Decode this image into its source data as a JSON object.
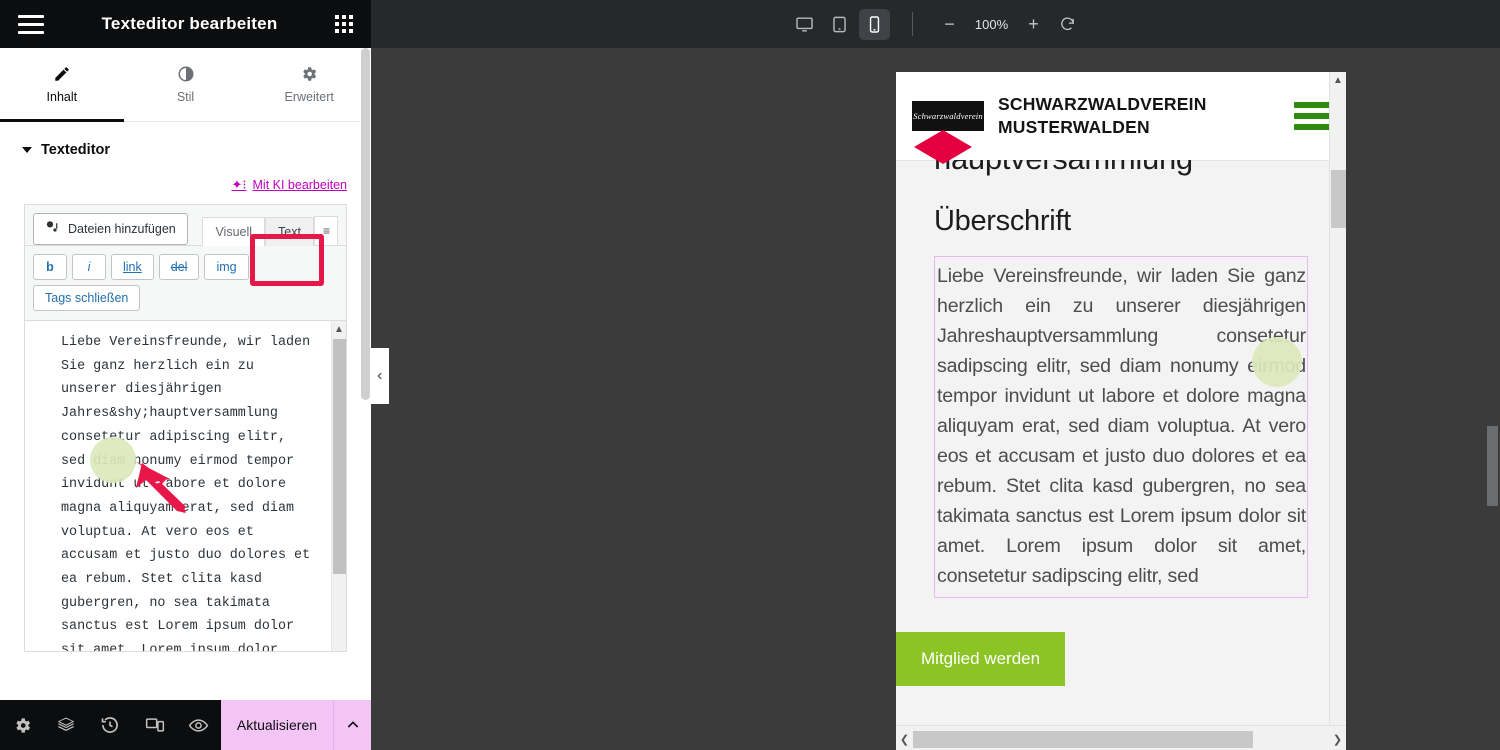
{
  "panel": {
    "title": "Texteditor bearbeiten",
    "menu_icon": "hamburger-icon",
    "apps_icon": "grid-apps-icon",
    "tabs": [
      {
        "label": "Inhalt",
        "icon": "pencil-icon",
        "active": true
      },
      {
        "label": "Stil",
        "icon": "contrast-icon",
        "active": false
      },
      {
        "label": "Erweitert",
        "icon": "gear-icon",
        "active": false
      }
    ],
    "section_title": "Texteditor",
    "ai_link": "Mit KI bearbeiten",
    "ai_icon": "sparkle-icon",
    "add_media": "Dateien hinzufügen",
    "add_media_icon": "media-camera-icon",
    "editor_tabs": [
      {
        "label": "Visuell",
        "selected": false
      },
      {
        "label": "Text",
        "selected": true
      }
    ],
    "kebab_icon": "kebab-menu-icon",
    "quicktags": [
      "b",
      "i",
      "link",
      "del",
      "img",
      "Tags schließen"
    ],
    "textarea_value": "Liebe Vereinsfreunde, wir laden Sie ganz herzlich ein zu unserer diesjährigen Jahres&shy;hauptversammlung consetetur adipiscing elitr, sed diam nonumy eirmod tempor invidunt ut labore et dolore magna aliquyam erat, sed diam voluptua. At vero eos et accusam et justo duo dolores et ea rebum. Stet clita kasd gubergren, no sea takimata sanctus est Lorem ipsum dolor sit amet. Lorem ipsum dolor",
    "footer": {
      "icons": [
        {
          "name": "settings-gear-icon"
        },
        {
          "name": "layers-navigator-icon"
        },
        {
          "name": "history-icon"
        },
        {
          "name": "responsive-preview-icon"
        },
        {
          "name": "preview-eye-icon"
        }
      ],
      "update_label": "Aktualisieren",
      "update_caret_icon": "chevron-up-icon",
      "update_color": "#f3c5f7"
    },
    "collapse_icon": "chevron-left-icon"
  },
  "topbar": {
    "devices": [
      {
        "name": "desktop",
        "icon": "desktop-icon",
        "active": false
      },
      {
        "name": "tablet",
        "icon": "tablet-icon",
        "active": false
      },
      {
        "name": "mobile",
        "icon": "mobile-icon",
        "active": true
      }
    ],
    "zoom_out_icon": "minus-icon",
    "zoom_level": "100%",
    "zoom_in_icon": "plus-icon",
    "zoom_reset_icon": "reset-rotate-icon"
  },
  "preview": {
    "logo_text": "Schwarzwaldverein",
    "site_name_line1": "SCHWARZWALDVEREIN",
    "site_name_line2": "MUSTERWALDEN",
    "menu_icon": "hamburger-green-icon",
    "menu_color": "#2e8b0b",
    "diamond_color": "#e4003f",
    "heading_cut": "hauptversammlung",
    "sub_heading": "Überschrift",
    "body_text": "Liebe Vereinsfreunde, wir laden Sie ganz herzlich ein zu unserer diesjährigen Jahres­hauptversammlung consetetur sadipscing elitr, sed diam nonumy eirmod tempor invidunt ut labore et dolore magna aliquyam erat, sed diam voluptua. At vero eos et accusam et justo duo dolores et ea rebum. Stet clita kasd gubergren, no sea takimata sanctus est Lorem ipsum dolor sit amet. Lorem ipsum dolor sit amet, consetetur sadipscing elitr, sed",
    "cta_label": "Mitglied werden",
    "cta_color": "#8cc425",
    "selection_border_color": "#eab8f0",
    "hsb_left_icon": "chevron-left-icon",
    "hsb_right_icon": "chevron-right-icon",
    "vsb_up_icon": "chevron-up-icon",
    "vsb_down_icon": "chevron-down-icon"
  },
  "annotations": {
    "box_color": "#e8174a",
    "arrow_color": "#e8174a",
    "highlight_color": "#dde8bc",
    "box_target": "Text",
    "arrow_target": "&shy;"
  }
}
